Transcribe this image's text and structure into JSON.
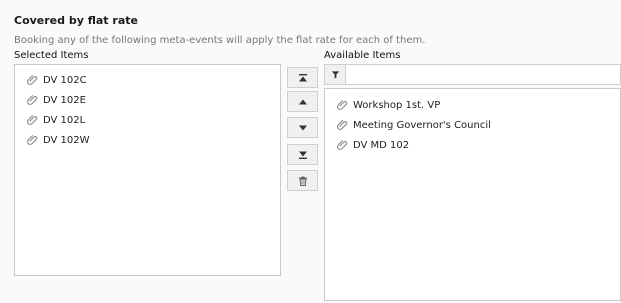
{
  "section": {
    "title": "Covered by flat rate",
    "description": "Booking any of the following meta-events will apply the flat rate for each of them."
  },
  "selected": {
    "label": "Selected Items",
    "items": [
      "DV 102C",
      "DV 102E",
      "DV 102L",
      "DV 102W"
    ]
  },
  "available": {
    "label": "Available Items",
    "filter_placeholder": "",
    "items": [
      "Workshop 1st. VP",
      "Meeting Governor's Council",
      "DV MD 102"
    ]
  },
  "icons": {
    "item": "paperclip-icon",
    "move_top": "move-to-top-icon",
    "move_up": "move-up-icon",
    "move_down": "move-down-icon",
    "move_bottom": "move-to-bottom-icon",
    "delete": "trash-icon",
    "filter": "filter-icon"
  }
}
